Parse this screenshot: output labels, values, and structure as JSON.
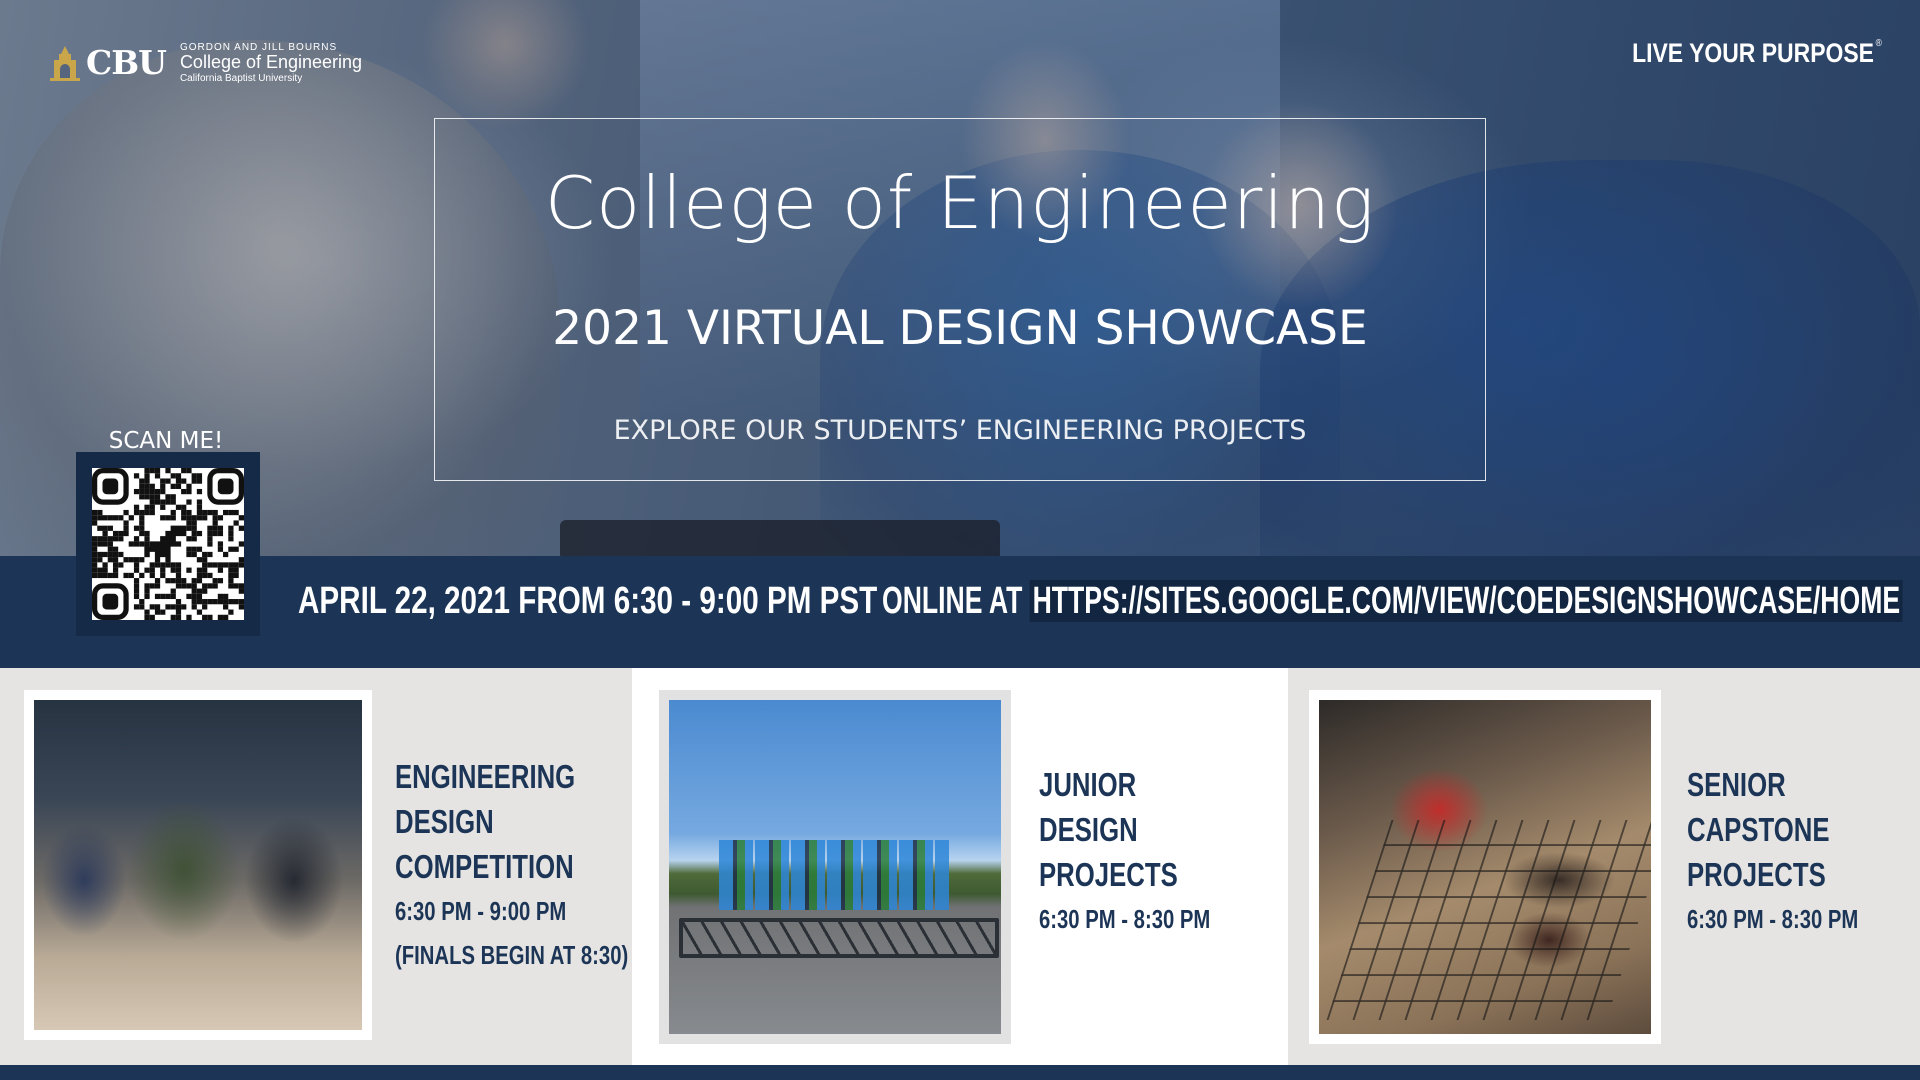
{
  "header": {
    "logo_abbrev": "CBU",
    "logo_line1": "GORDON AND JILL BOURNS",
    "logo_line2": "College of Engineering",
    "logo_line3": "California Baptist University",
    "tagline": "LIVE YOUR PURPOSE",
    "tagline_mark": "®"
  },
  "hero": {
    "title": "College of Engineering",
    "subtitle": "2021 VIRTUAL DESIGN SHOWCASE",
    "explore": "EXPLORE OUR STUDENTS’ ENGINEERING PROJECTS"
  },
  "qr": {
    "label": "SCAN ME!",
    "icon": "dinosaur-icon"
  },
  "info_bar": {
    "date_text": "APRIL 22, 2021 FROM 6:30 - 9:00 PM PST",
    "online_prefix": "ONLINE AT ",
    "url": "HTTPS://SITES.GOOGLE.COM/VIEW/COEDESIGNSHOWCASE/HOME"
  },
  "cards": [
    {
      "title_lines": [
        "ENGINEERING",
        "DESIGN",
        "COMPETITION"
      ],
      "time": "6:30 PM - 9:00 PM",
      "note": "(FINALS BEGIN AT 8:30)"
    },
    {
      "title_lines": [
        "JUNIOR",
        "DESIGN",
        "PROJECTS"
      ],
      "time": "6:30 PM - 8:30 PM"
    },
    {
      "title_lines": [
        "SENIOR",
        "CAPSTONE",
        "PROJECTS"
      ],
      "time": "6:30 PM - 8:30 PM"
    }
  ],
  "colors": {
    "navy": "#1c3556",
    "card_grey": "#e5e4e2",
    "white": "#ffffff",
    "logo_gold": "#c9a64a"
  }
}
